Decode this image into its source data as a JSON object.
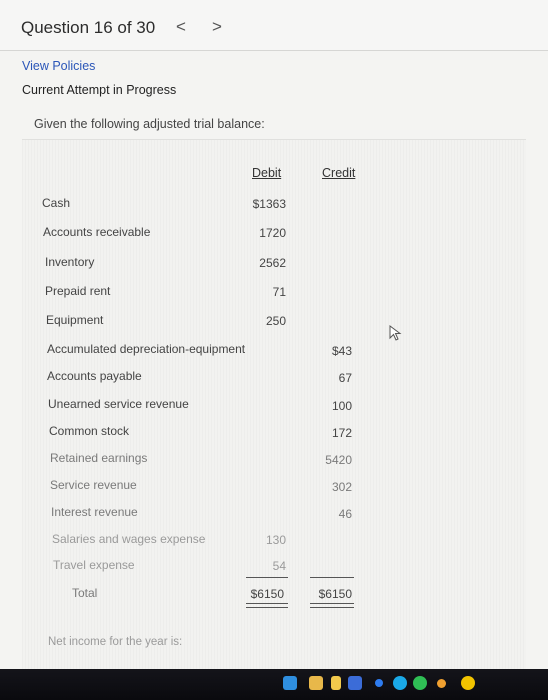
{
  "header": {
    "question_label": "Question 16 of 30",
    "prev_label": "<",
    "next_label": ">"
  },
  "links": {
    "view_policies": "View Policies",
    "attempt_status": "Current Attempt in Progress"
  },
  "prompt": "Given the following adjusted trial balance:",
  "table": {
    "debit_header": "Debit",
    "credit_header": "Credit",
    "rows": [
      {
        "label": "Cash",
        "debit": "$1363",
        "credit": ""
      },
      {
        "label": "Accounts receivable",
        "debit": "1720",
        "credit": ""
      },
      {
        "label": "Inventory",
        "debit": "2562",
        "credit": ""
      },
      {
        "label": "Prepaid rent",
        "debit": "71",
        "credit": ""
      },
      {
        "label": "Equipment",
        "debit": "250",
        "credit": ""
      },
      {
        "label": "Accumulated depreciation-equipment",
        "debit": "",
        "credit": "$43"
      },
      {
        "label": "Accounts payable",
        "debit": "",
        "credit": "67"
      },
      {
        "label": "Unearned service revenue",
        "debit": "",
        "credit": "100"
      },
      {
        "label": "Common stock",
        "debit": "",
        "credit": "172"
      },
      {
        "label": "Retained earnings",
        "debit": "",
        "credit": "5420"
      },
      {
        "label": "Service revenue",
        "debit": "",
        "credit": "302"
      },
      {
        "label": "Interest revenue",
        "debit": "",
        "credit": "46"
      },
      {
        "label": "Salaries and wages expense",
        "debit": "130",
        "credit": ""
      },
      {
        "label": "Travel expense",
        "debit": "54",
        "credit": ""
      }
    ],
    "total_label": "Total",
    "total_debit": "$6150",
    "total_credit": "$6150"
  },
  "question_text": "Net income for the year is:",
  "taskbar": {
    "icons": [
      "windows-start-icon",
      "folder-icon",
      "app-icon",
      "store-icon",
      "chrome-icon",
      "green-app-icon",
      "blue-app-icon",
      "orange-app-icon",
      "yellow-app-icon"
    ]
  },
  "colors": {
    "link": "#2b56b8",
    "background": "#f4f4f2",
    "taskbar": "#0f0f14"
  }
}
